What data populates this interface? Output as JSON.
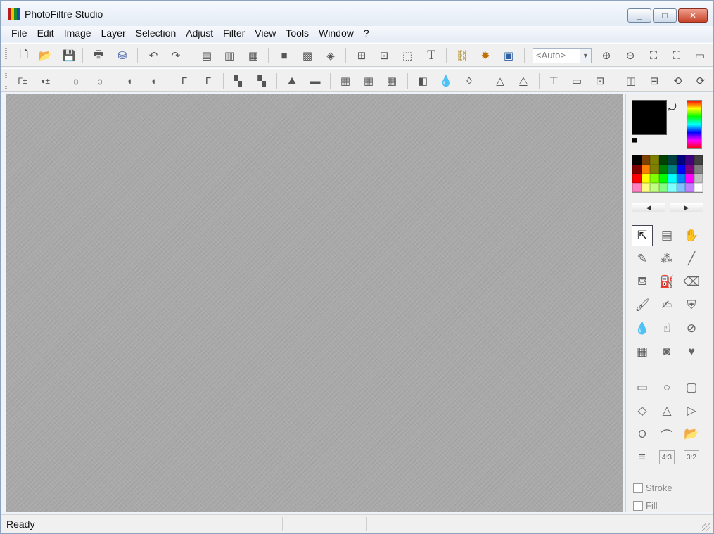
{
  "window": {
    "title": "PhotoFiltre Studio",
    "controls": [
      "_",
      "□",
      "✕"
    ]
  },
  "menu": [
    "File",
    "Edit",
    "Image",
    "Layer",
    "Selection",
    "Adjust",
    "Filter",
    "View",
    "Tools",
    "Window",
    "?"
  ],
  "toolbar1": {
    "icons": [
      "new-icon",
      "open-icon",
      "save-icon",
      "print-icon",
      "scan-icon",
      "undo-icon",
      "redo-icon",
      "layer-copy-icon",
      "layer-paste-icon",
      "layer-merge-icon",
      "frame-icon",
      "grid-icon",
      "effect-icon",
      "image-size-icon",
      "canvas-size-icon",
      "crop-icon",
      "text-icon",
      "explorer-icon",
      "palette-icon",
      "window-icon",
      "zoom-in-icon",
      "zoom-out-icon",
      "fit-icon",
      "actual-size-icon",
      "fullscreen-icon"
    ],
    "zoom_value": "<Auto>"
  },
  "toolbar2": {
    "icons": [
      "auto-levels-icon",
      "auto-contrast-icon",
      "brightness-minus-icon",
      "brightness-plus-icon",
      "contrast-minus-icon",
      "contrast-plus-icon",
      "gamma-minus-icon",
      "gamma-plus-icon",
      "saturation-minus-icon",
      "saturation-plus-icon",
      "grayscale-icon",
      "sepia-icon",
      "soften-icon",
      "blur-icon",
      "sharpen-icon",
      "more-icon",
      "drop-icon",
      "drop-outline-icon",
      "pen-tip-icon",
      "pen-tip-outline-icon",
      "frame-top-icon",
      "frame-right-icon",
      "frame-center-icon",
      "mirror-icon",
      "flip-icon",
      "rotate-icon",
      "rotate-free-icon"
    ]
  },
  "colors": {
    "foreground": "#000000",
    "background": "#FFFFFF",
    "palette": [
      "#000000",
      "#804000",
      "#808000",
      "#004000",
      "#004040",
      "#000080",
      "#400080",
      "#404040",
      "#800000",
      "#ff8000",
      "#808000",
      "#008000",
      "#008080",
      "#0000ff",
      "#800080",
      "#808080",
      "#ff0000",
      "#ffff00",
      "#80ff00",
      "#00ff00",
      "#00ffff",
      "#0080ff",
      "#ff00ff",
      "#c0c0c0",
      "#ff80c0",
      "#ffff80",
      "#c0ff80",
      "#80ff80",
      "#80ffff",
      "#80c0ff",
      "#c080ff",
      "#ffffff"
    ]
  },
  "tools": {
    "main": [
      "select-icon",
      "layer-manager-icon",
      "hand-icon",
      "pipette-icon",
      "magic-wand-icon",
      "line-icon",
      "fill-bucket-icon",
      "spray-icon",
      "eraser-icon",
      "brush-icon",
      "advanced-brush-icon",
      "stamp-icon",
      "blur-drop-icon",
      "smudge-icon",
      "red-eye-icon",
      "pattern-icon",
      "image-tube-icon",
      "heart-icon"
    ],
    "shapes": [
      "rectangle-icon",
      "ellipse-icon",
      "rounded-rectangle-icon",
      "diamond-icon",
      "triangle-icon",
      "arrow-right-icon",
      "lasso-icon",
      "polygon-lasso-icon",
      "shape-open-icon",
      "ratio-free-icon",
      "ratio-4-3-icon",
      "ratio-3-2-icon"
    ],
    "shape_glyphs": [
      "▭",
      "○",
      "▢",
      "◇",
      "△",
      "▷",
      "ଠ",
      "⌒",
      "📂",
      "≡",
      "4:3",
      "3:2"
    ],
    "stroke_label": "Stroke",
    "fill_label": "Fill"
  },
  "status": {
    "text": "Ready"
  }
}
